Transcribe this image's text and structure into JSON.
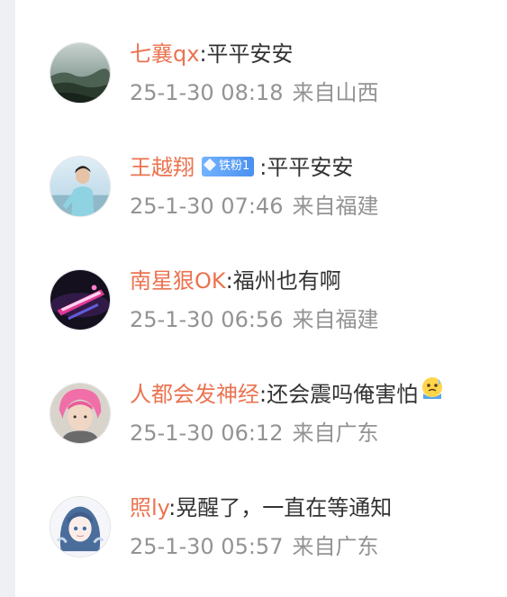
{
  "colors": {
    "username": "#eb7350",
    "text": "#333333",
    "meta": "#939393",
    "badge": "#5b9ff5",
    "left_strip": "#eef0f4"
  },
  "separator": ":",
  "comments": [
    {
      "username": "七襄qx",
      "text": "平平安安",
      "time": "25-1-30 08:18",
      "location": "来自山西",
      "avatar_icon": "avatar-landscape"
    },
    {
      "username": "王越翔",
      "badge": "铁粉1",
      "badge_icon": "diamond-icon",
      "text": "平平安安",
      "time": "25-1-30 07:46",
      "location": "来自福建",
      "avatar_icon": "avatar-person-photo"
    },
    {
      "username": "南星狠OK",
      "text": "福州也有啊",
      "time": "25-1-30 06:56",
      "location": "来自福建",
      "avatar_icon": "avatar-neon-light"
    },
    {
      "username": "人都会发神经",
      "text": "还会震吗俺害怕",
      "emoji_icon": "scared-face-emoji-icon",
      "time": "25-1-30 06:12",
      "location": "来自广东",
      "avatar_icon": "avatar-pink-hair"
    },
    {
      "username": "照ly",
      "text": "晃醒了，一直在等通知",
      "time": "25-1-30 05:57",
      "location": "来自广东",
      "avatar_icon": "avatar-anime-girl"
    }
  ]
}
